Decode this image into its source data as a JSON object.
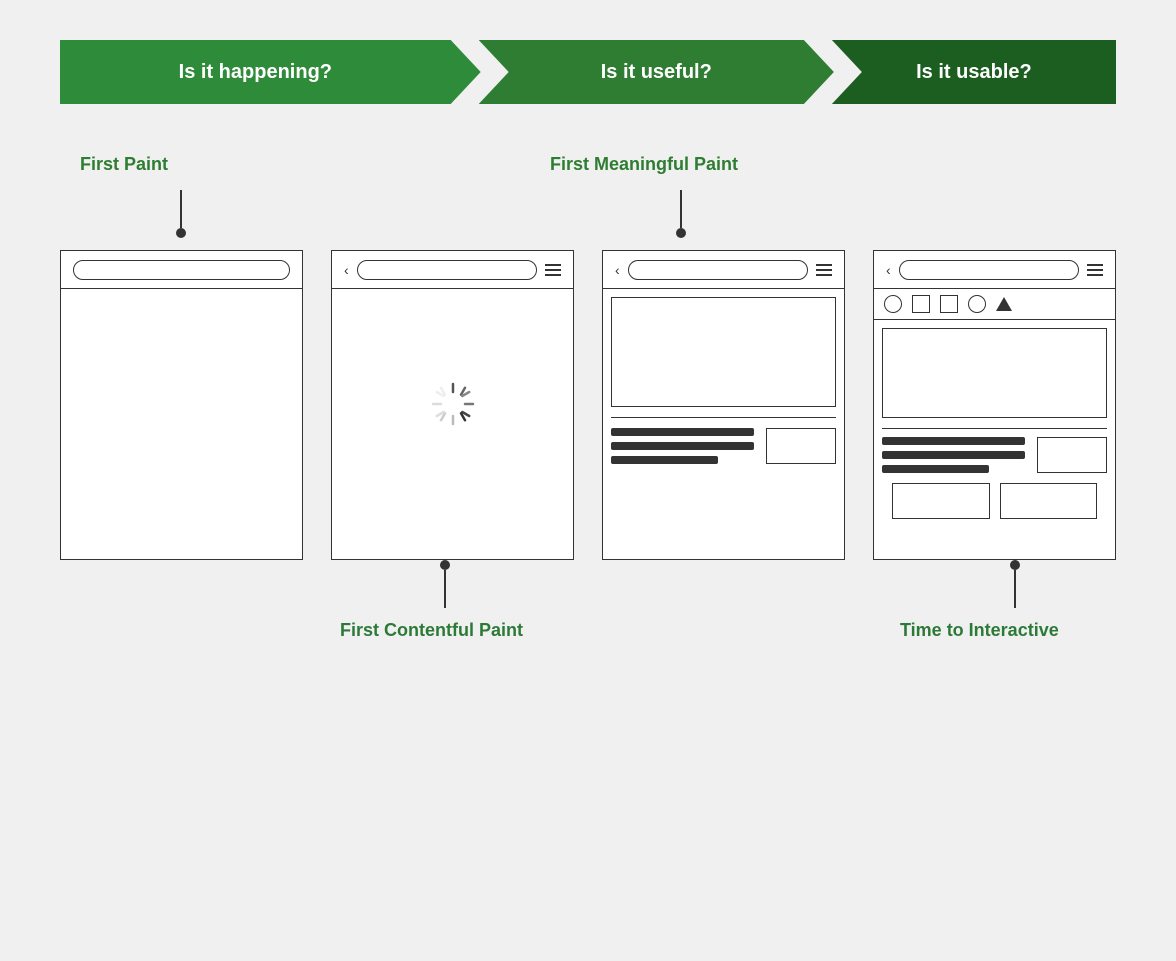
{
  "banner": {
    "arrow1": "Is it happening?",
    "arrow2": "Is it useful?",
    "arrow3": "Is it usable?"
  },
  "labels": {
    "first_paint": "First Paint",
    "first_meaningful_paint": "First Meaningful Paint",
    "first_contentful_paint": "First Contentful Paint",
    "time_to_interactive": "Time to Interactive"
  },
  "colors": {
    "green_bright": "#3a9e48",
    "green_mid": "#2e8b3a",
    "green_dark": "#1b5e20",
    "label_green": "#2d7a38",
    "text": "#333333"
  }
}
